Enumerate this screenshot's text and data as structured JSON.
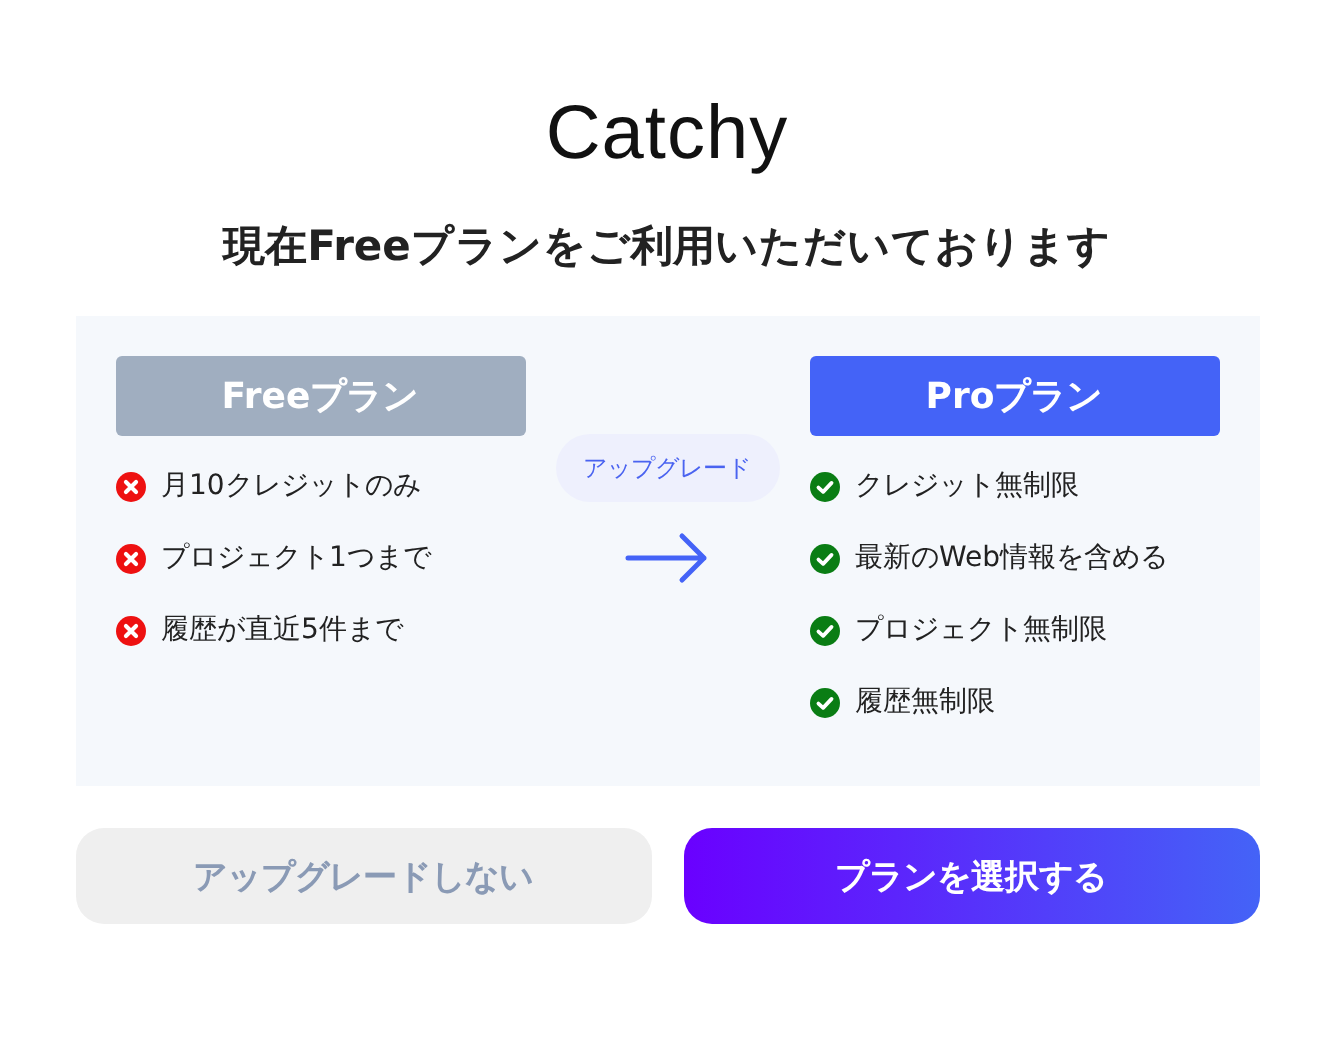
{
  "logo": "Catchy",
  "title": "現在Freeプランをご利用いただいております",
  "plans": [
    {
      "name": "Freeプラン",
      "kind": "current",
      "features": [
        {
          "text": "月10クレジットのみ",
          "kind": "excluded"
        },
        {
          "text": "プロジェクト1つまで",
          "kind": "excluded"
        },
        {
          "text": "履歴が直近5件まで",
          "kind": "excluded"
        }
      ]
    },
    {
      "name": "Proプラン",
      "kind": "upgrade",
      "features": [
        {
          "text": "クレジット無制限",
          "kind": "included"
        },
        {
          "text": "最新のWeb情報を含める",
          "kind": "included"
        },
        {
          "text": "プロジェクト無制限",
          "kind": "included"
        },
        {
          "text": "履歴無制限",
          "kind": "included"
        }
      ]
    }
  ],
  "upgrade_badge": "アップグレード",
  "buttons": [
    {
      "label": "アップグレードしない",
      "kind": "secondary"
    },
    {
      "label": "プランを選択する",
      "kind": "primary"
    }
  ]
}
